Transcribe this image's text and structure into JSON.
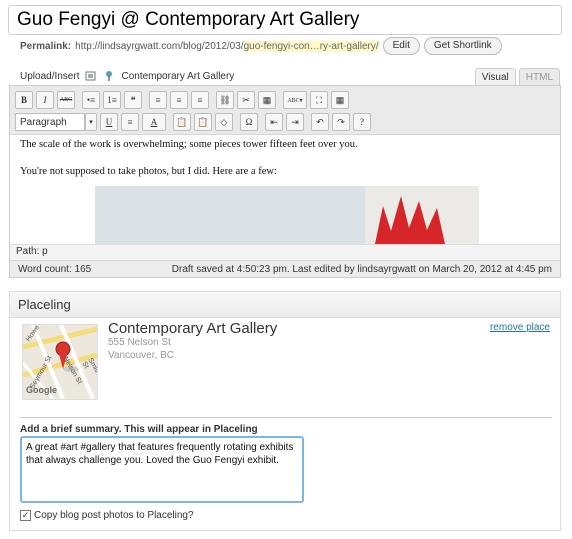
{
  "post": {
    "title": "Guo Fengyi @ Contemporary Art Gallery",
    "permalink_label": "Permalink:",
    "permalink_base": "http://lindsayrgwatt.com/blog/2012/03/",
    "permalink_slug": "guo-fengyi-con…ry-art-gallery/",
    "edit_label": "Edit",
    "shortlink_label": "Get Shortlink"
  },
  "upload": {
    "label": "Upload/Insert",
    "gallery_label": "Contemporary Art Gallery"
  },
  "tabs": [
    {
      "label": "Visual",
      "active": true
    },
    {
      "label": "HTML",
      "active": false
    }
  ],
  "toolbar": {
    "row1": [
      "B",
      "I",
      "ABC",
      "•≡",
      "1≡",
      "❝",
      "≡",
      "≡",
      "≡",
      "⛓",
      "✂",
      "▦",
      "ABC▾",
      "⛶",
      "▦"
    ],
    "format_select": "Paragraph",
    "row2": [
      "U",
      "≡",
      "A",
      "📋",
      "📋",
      "◇",
      "Ω",
      "⇤",
      "⇥",
      "↶",
      "↷",
      "?"
    ]
  },
  "content": {
    "p1": "The scale of the work is overwhelming; some pieces tower fifteen feet over you.",
    "p2": "You're not supposed to take photos, but I did. Here are a few:"
  },
  "path": "Path: p",
  "status": {
    "word_count": "Word count: 165",
    "draft_saved": "Draft saved at 4:50:23 pm. Last edited by lindsayrgwatt on March 20, 2012 at 4:45 pm"
  },
  "placeling": {
    "header": "Placeling",
    "place_name": "Contemporary Art Gallery",
    "address_line1": "555 Nelson St",
    "address_line2": "Vancouver, BC",
    "remove_link": "remove place",
    "summary_label": "Add a brief summary. This will appear in Placeling",
    "summary_text": "A great #art #gallery that features frequently rotating exhibits that always challenge you. Loved the Guo Fengyi exhibit.",
    "copy_photos_label": "Copy blog post photos to Placeling?",
    "copy_photos_checked": true,
    "map_labels": [
      "Howe St",
      "Nelson St",
      "Smithe St",
      "Seymour St",
      "Google"
    ]
  },
  "colors": {
    "link": "#21759b",
    "focus_border": "#7eb6e2",
    "slug_highlight": "#fff8c8",
    "pin": "#d9352c"
  }
}
